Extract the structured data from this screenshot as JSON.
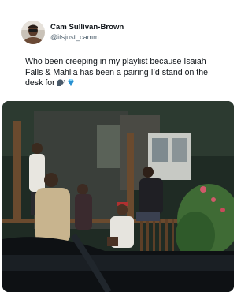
{
  "author": {
    "display_name": "Cam Sullivan-Brown",
    "handle": "@itsjust_camm",
    "avatar_icon": "profile-photo-man-in-sunglasses"
  },
  "tweet": {
    "text": "Who been creeping in my playlist because Isaiah Falls & Mahlia has been a pairing I’d stand on the desk for",
    "emojis": [
      "speaking-head-emoji",
      "gem-stone-emoji"
    ]
  },
  "media": {
    "description_icon": "video-still-group-on-porch"
  }
}
